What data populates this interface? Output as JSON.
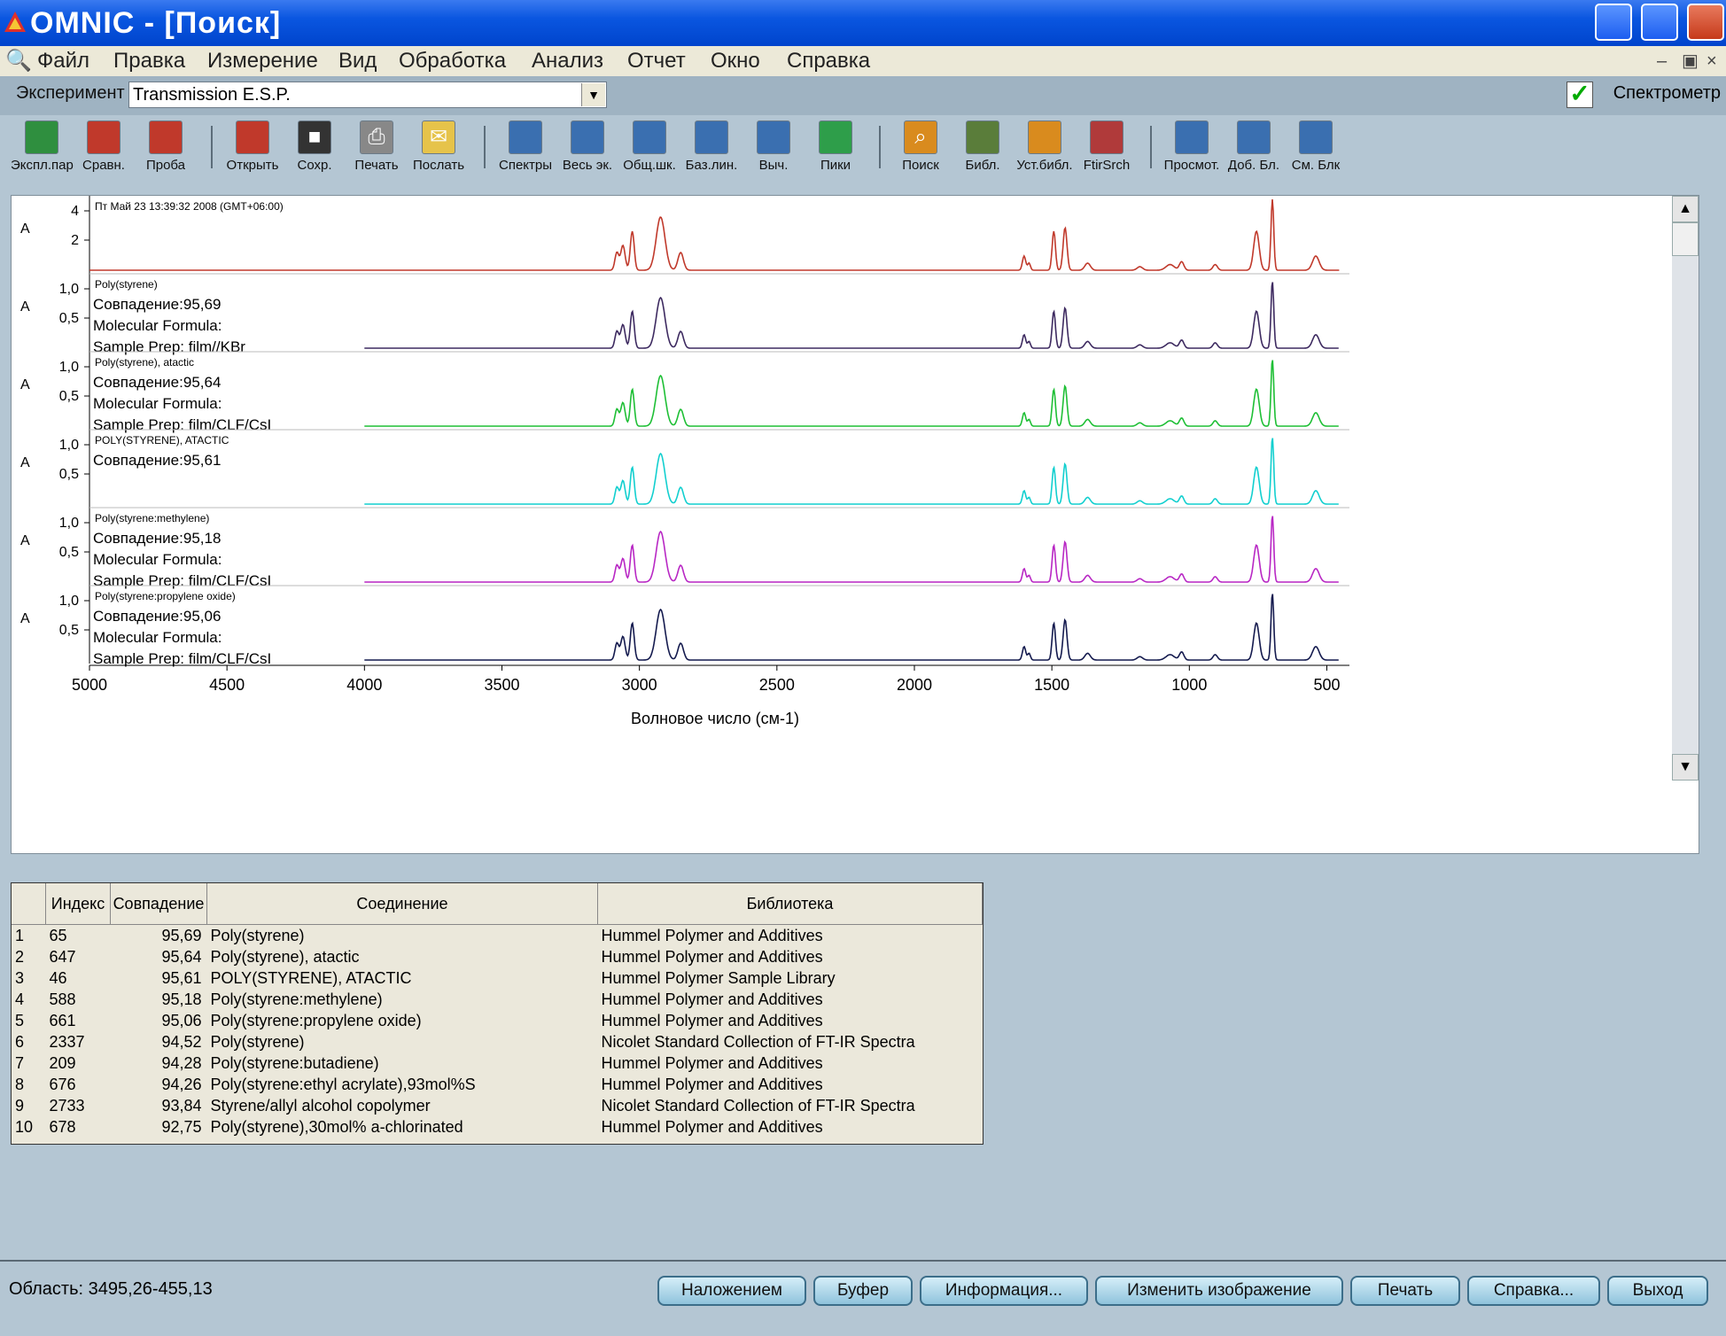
{
  "window": {
    "title": "OMNIC - [Поиск]"
  },
  "menu": [
    "Файл",
    "Правка",
    "Измерение",
    "Вид",
    "Обработка",
    "Анализ",
    "Отчет",
    "Окно",
    "Справка"
  ],
  "experiment": {
    "label": "Эксперимент",
    "value": "Transmission E.S.P.",
    "spectrometer_label": "Спектрометр"
  },
  "toolbar": [
    {
      "label": "Экспл.пар",
      "icon": "experiment-setup-icon",
      "color": "#2f8f3f"
    },
    {
      "label": "Сравн.",
      "icon": "background-icon",
      "color": "#c0392b"
    },
    {
      "label": "Проба",
      "icon": "sample-icon",
      "color": "#c0392b"
    },
    {
      "label": "Открыть",
      "icon": "open-icon",
      "color": "#c0392b"
    },
    {
      "label": "Сохр.",
      "icon": "save-icon",
      "color": "#333333"
    },
    {
      "label": "Печать",
      "icon": "print-icon",
      "color": "#888888"
    },
    {
      "label": "Послать",
      "icon": "mail-icon",
      "color": "#e6c34a"
    },
    {
      "label": "Спектры",
      "icon": "display-spectra-icon",
      "color": "#3a6fb0"
    },
    {
      "label": "Весь эк.",
      "icon": "full-scale-icon",
      "color": "#3a6fb0"
    },
    {
      "label": "Общ.шк.",
      "icon": "common-scale-icon",
      "color": "#3a6fb0"
    },
    {
      "label": "Баз.лин.",
      "icon": "baseline-icon",
      "color": "#3a6fb0"
    },
    {
      "label": "Выч.",
      "icon": "subtract-icon",
      "color": "#3a6fb0"
    },
    {
      "label": "Пики",
      "icon": "peaks-icon",
      "color": "#2e9e4a"
    },
    {
      "label": "Поиск",
      "icon": "search-icon",
      "color": "#d98b1e"
    },
    {
      "label": "Библ.",
      "icon": "library-icon",
      "color": "#5a7d3a"
    },
    {
      "label": "Уст.библ.",
      "icon": "library-setup-icon",
      "color": "#d98b1e"
    },
    {
      "label": "FtirSrch",
      "icon": "ftir-search-icon",
      "color": "#b03a3a"
    },
    {
      "label": "Просмот.",
      "icon": "view-icon",
      "color": "#3a6fb0"
    },
    {
      "label": "Доб. Бл.",
      "icon": "add-block-icon",
      "color": "#3a6fb0"
    },
    {
      "label": "См. Блк",
      "icon": "view-block-icon",
      "color": "#3a6fb0"
    }
  ],
  "chart_data": {
    "type": "line",
    "xlabel": "Волновое число (см-1)",
    "xlim": [
      5000,
      450
    ],
    "xticks": [
      "5000",
      "4500",
      "4000",
      "3500",
      "3000",
      "2500",
      "2000",
      "1500",
      "1000",
      "500"
    ],
    "y_axis_label": "A",
    "panels": [
      {
        "header": "Пт Май 23 13:39:32 2008 (GMT+06:00)",
        "lines": [],
        "color": "#c0392b",
        "yticks": [
          "4",
          "2"
        ],
        "x_start": 5000
      },
      {
        "header": "Poly(styrene)",
        "lines": [
          "Совпадение:95,69",
          "Molecular Formula:",
          "Sample Prep:  film//KBr"
        ],
        "color": "#3d2a60",
        "yticks": [
          "1,0",
          "0,5"
        ],
        "x_start": 4000
      },
      {
        "header": "Poly(styrene), atactic",
        "lines": [
          "Совпадение:95,64",
          "Molecular Formula:",
          "Sample Prep:  film/CLF/CsI"
        ],
        "color": "#1ebf35",
        "yticks": [
          "1,0",
          "0,5"
        ],
        "x_start": 4000
      },
      {
        "header": "POLY(STYRENE), ATACTIC",
        "lines": [
          "Совпадение:95,61"
        ],
        "color": "#12cfcf",
        "yticks": [
          "1,0",
          "0,5"
        ],
        "x_start": 4000
      },
      {
        "header": "Poly(styrene:methylene)",
        "lines": [
          "Совпадение:95,18",
          "Molecular Formula:",
          "Sample Prep:  film/CLF/CsI"
        ],
        "color": "#b827c4",
        "yticks": [
          "1,0",
          "0,5"
        ],
        "x_start": 4000
      },
      {
        "header": "Poly(styrene:propylene oxide)",
        "lines": [
          "Совпадение:95,06",
          "Molecular Formula:",
          "Sample Prep:  film/CLF/CsI"
        ],
        "color": "#141a4e",
        "yticks": [
          "1,0",
          "0,5"
        ],
        "x_start": 4000
      }
    ]
  },
  "results": {
    "columns": [
      "",
      "Индекс",
      "Совпадение",
      "Соединение",
      "Библиотека"
    ],
    "rows": [
      [
        "1",
        "65",
        "95,69",
        "Poly(styrene)",
        "Hummel Polymer and Additives"
      ],
      [
        "2",
        "647",
        "95,64",
        "Poly(styrene), atactic",
        "Hummel Polymer and Additives"
      ],
      [
        "3",
        "46",
        "95,61",
        "POLY(STYRENE), ATACTIC",
        "Hummel Polymer Sample Library"
      ],
      [
        "4",
        "588",
        "95,18",
        "Poly(styrene:methylene)",
        "Hummel Polymer and Additives"
      ],
      [
        "5",
        "661",
        "95,06",
        "Poly(styrene:propylene oxide)",
        "Hummel Polymer and Additives"
      ],
      [
        "6",
        "2337",
        "94,52",
        "Poly(styrene)",
        "Nicolet Standard Collection of FT-IR Spectra"
      ],
      [
        "7",
        "209",
        "94,28",
        "Poly(styrene:butadiene)",
        "Hummel Polymer and Additives"
      ],
      [
        "8",
        "676",
        "94,26",
        "Poly(styrene:ethyl acrylate),93mol%S",
        "Hummel Polymer and Additives"
      ],
      [
        "9",
        "2733",
        "93,84",
        "Styrene/allyl alcohol copolymer",
        "Nicolet Standard Collection of FT-IR Spectra"
      ],
      [
        "10",
        "678",
        "92,75",
        "Poly(styrene),30mol% a-chlorinated",
        "Hummel Polymer and Additives"
      ]
    ]
  },
  "status": {
    "area": "Область:  3495,26-455,13"
  },
  "buttons": [
    "Наложением",
    "Буфер",
    "Информация...",
    "Изменить изображение",
    "Печать",
    "Справка...",
    "Выход"
  ]
}
